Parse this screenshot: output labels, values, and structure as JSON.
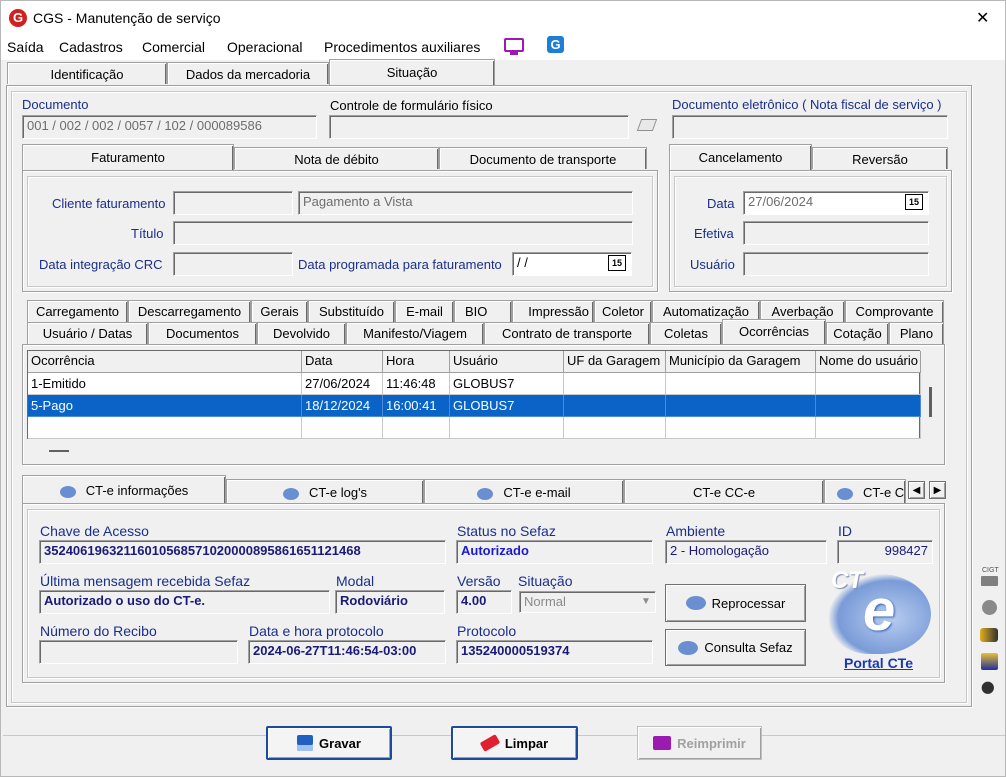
{
  "window": {
    "title": "CGS - Manutenção de serviço",
    "close": "✕"
  },
  "menu": [
    "Saída",
    "Cadastros",
    "Comercial",
    "Operacional",
    "Procedimentos auxiliares"
  ],
  "main_tabs": [
    "Identificação",
    "Dados da mercadoria",
    "Situação"
  ],
  "top": {
    "documento_label": "Documento",
    "documento_value": "001 / 002 / 002 / 0057 / 102 / 000089586",
    "controle_label": "Controle de formulário físico",
    "controle_value": "",
    "doc_eletronico_label": "Documento eletrônico ( Nota fiscal de serviço )",
    "doc_eletronico_value": ""
  },
  "fat_tabs": [
    "Faturamento",
    "Nota de débito",
    "Documento de transporte"
  ],
  "fat": {
    "cliente_label": "Cliente faturamento",
    "cliente_code": "",
    "cliente_value": "Pagamento a Vista",
    "titulo_label": "Título",
    "titulo_value": "",
    "data_crc_label": "Data integração CRC",
    "data_crc_value": "",
    "data_prog_label": "Data programada para faturamento",
    "data_prog_value": " /  /",
    "cal": "15"
  },
  "canc_tabs": [
    "Cancelamento",
    "Reversão"
  ],
  "canc": {
    "data_label": "Data",
    "data_value": "27/06/2024",
    "efetiva_label": "Efetiva",
    "efetiva_value": "",
    "usuario_label": "Usuário",
    "usuario_value": "",
    "cal": "15"
  },
  "tabs_row1": [
    "Carregamento",
    "Descarregamento",
    "Gerais",
    "Substituído",
    "E-mail",
    "BIO",
    "Impressão",
    "Coletor",
    "Automatização",
    "Averbação",
    "Comprovante"
  ],
  "tabs_row2": [
    "Usuário / Datas",
    "Documentos",
    "Devolvido",
    "Manifesto/Viagem",
    "Contrato de transporte",
    "Coletas",
    "Ocorrências",
    "Cotação",
    "Plano"
  ],
  "grid": {
    "headers": [
      "Ocorrência",
      "Data",
      "Hora",
      "Usuário",
      "UF da Garagem",
      "Município da Garagem",
      "Nome do usuário"
    ],
    "rows": [
      [
        "1-Emitido",
        "27/06/2024",
        "11:46:48",
        "GLOBUS7",
        "",
        "",
        ""
      ],
      [
        "5-Pago",
        "18/12/2024",
        "16:00:41",
        "GLOBUS7",
        "",
        "",
        ""
      ]
    ]
  },
  "cte_tabs": [
    "CT-e informações",
    "CT-e log's",
    "CT-e e-mail",
    "CT-e CC-e",
    "CT-e C"
  ],
  "cte": {
    "chave_label": "Chave de Acesso",
    "chave_value": "35240619632116010568571020000895861651121468",
    "status_label": "Status no Sefaz",
    "status_value": "Autorizado",
    "ambiente_label": "Ambiente",
    "ambiente_value": "2 - Homologação",
    "id_label": "ID",
    "id_value": "998427",
    "ultima_label": "Última mensagem recebida Sefaz",
    "ultima_value": "Autorizado o uso do CT-e.",
    "modal_label": "Modal",
    "modal_value": "Rodoviário",
    "versao_label": "Versão",
    "versao_value": "4.00",
    "situacao_label": "Situação",
    "situacao_value": "Normal",
    "recibo_label": "Número do Recibo",
    "recibo_value": "",
    "datahora_label": "Data e hora protocolo",
    "datahora_value": "2024-06-27T11:46:54-03:00",
    "protocolo_label": "Protocolo",
    "protocolo_value": "135240000519374",
    "reprocessar": "Reprocessar",
    "consulta": "Consulta Sefaz",
    "portal": "Portal CTe",
    "logo_text": "CT"
  },
  "side_label": "CIGT",
  "footer": {
    "gravar": "Gravar",
    "limpar": "Limpar",
    "reimprimir": "Reimprimir"
  }
}
